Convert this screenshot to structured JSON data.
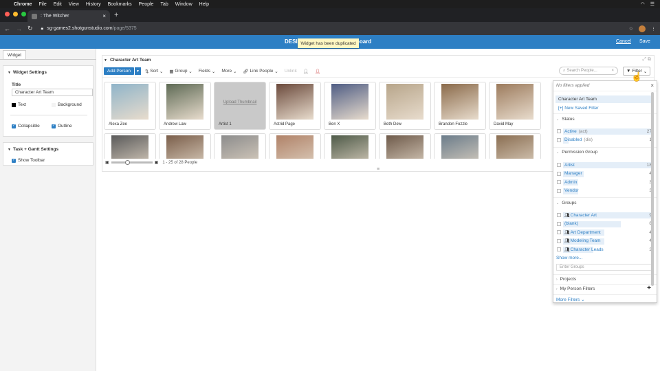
{
  "menubar": {
    "app": "Chrome",
    "items": [
      "File",
      "Edit",
      "View",
      "History",
      "Bookmarks",
      "People",
      "Tab",
      "Window",
      "Help"
    ]
  },
  "browser": {
    "tab_title": ": The Witcher",
    "url_host": "sg-games2.shotgunstudio.com",
    "url_path": "/page/5375"
  },
  "header": {
    "page_name_left": "DESI",
    "page_name_right": "board",
    "toast": "Widget has been duplicated",
    "cancel": "Cancel",
    "save": "Save"
  },
  "left_panel": {
    "tab": "Widget",
    "widget_settings": {
      "heading": "Widget Settings",
      "title_label": "Title",
      "title_value": "Character Art Team",
      "text_label": "Text",
      "background_label": "Background",
      "collapsible": "Collapsible",
      "outline": "Outline"
    },
    "task_gantt": {
      "heading": "Task + Gantt Settings",
      "show_toolbar": "Show Toolbar"
    }
  },
  "widget": {
    "title": "Character Art Team",
    "toolbar": {
      "add_person": "Add Person",
      "sort": "Sort",
      "group": "Group",
      "fields": "Fields",
      "more": "More",
      "link_people": "Link People",
      "unlink": "Unlink",
      "search_placeholder": "Search People...",
      "filter": "Filter"
    },
    "cards_row1": [
      {
        "name": "Alexa Zee",
        "color": "#8fb4c9"
      },
      {
        "name": "Andrew Law",
        "color": "#5e6a55"
      },
      {
        "name": "Artist 1",
        "upload": "Upload Thumbnail"
      },
      {
        "name": "Astrid Page",
        "color": "#6b4a3c"
      },
      {
        "name": "Ben X",
        "color": "#4f5d84"
      },
      {
        "name": "Beth Dew",
        "color": "#b7a58a"
      },
      {
        "name": "Brandon Fozzle",
        "color": "#8a6a4a"
      },
      {
        "name": "David May",
        "color": "#9c7b5d"
      }
    ],
    "cards_row2_colors": [
      "#5a5a5a",
      "#7a5e4a",
      "#8c8c8c",
      "#b08268",
      "#4e5a48",
      "#6e5a4a",
      "#6b7c8a",
      "#8a6e52"
    ],
    "slider_min_icon": "small-grid-icon",
    "count_text": "1 - 25 of 28 People"
  },
  "filter_panel": {
    "no_filters": "No filters applied",
    "saved_filter": "Character Art Team",
    "new_saved": "[+] New Saved Filter",
    "status_heading": "Status",
    "status": [
      {
        "label": "Active",
        "sub": "(act)",
        "count": "27"
      },
      {
        "label": "Disabled",
        "sub": "(dis)",
        "count": "1"
      }
    ],
    "permission_heading": "Permission Group",
    "permission": [
      {
        "label": "Artist",
        "count": "18"
      },
      {
        "label": "Manager",
        "count": "4"
      },
      {
        "label": "Admin",
        "count": "3"
      },
      {
        "label": "Vendor",
        "count": "3"
      }
    ],
    "groups_heading": "Groups",
    "groups": [
      {
        "label": "Character Art",
        "count": "9",
        "icon": true
      },
      {
        "label": "(blank)",
        "count": "6",
        "icon": false
      },
      {
        "label": "Art Department",
        "count": "4",
        "icon": true
      },
      {
        "label": "Modeling Team",
        "count": "4",
        "icon": true
      },
      {
        "label": "Character Leads",
        "count": "3",
        "icon": true
      }
    ],
    "show_more": "Show more...",
    "enter_groups_placeholder": "Enter Groups",
    "projects_heading": "Projects",
    "my_person_filters": "My Person Filters",
    "more_filters": "More Filters"
  }
}
